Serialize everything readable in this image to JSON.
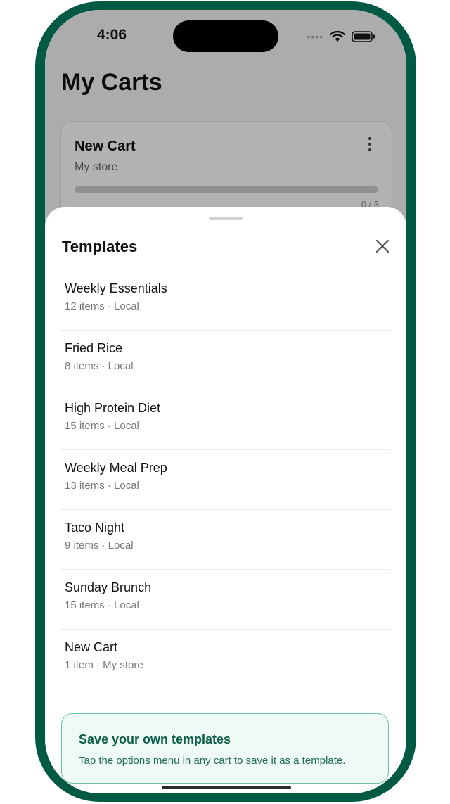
{
  "status_bar": {
    "time": "4:06"
  },
  "background": {
    "title": "My Carts",
    "card": {
      "title": "New Cart",
      "subtitle": "My store",
      "count": "0 / 3"
    }
  },
  "sheet": {
    "title": "Templates",
    "templates": [
      {
        "title": "Weekly Essentials",
        "subtitle": "12 items · Local"
      },
      {
        "title": "Fried Rice",
        "subtitle": "8 items · Local"
      },
      {
        "title": "High Protein Diet",
        "subtitle": "15 items · Local"
      },
      {
        "title": "Weekly Meal Prep",
        "subtitle": "13 items · Local"
      },
      {
        "title": "Taco Night",
        "subtitle": "9 items · Local"
      },
      {
        "title": "Sunday Brunch",
        "subtitle": "15 items · Local"
      },
      {
        "title": "New Cart",
        "subtitle": "1 item · My store"
      }
    ],
    "tip": {
      "title": "Save your own templates",
      "body": "Tap the options menu in any cart to save it as a template."
    }
  },
  "icons": {
    "close": "close-icon",
    "more": "more-vertical-icon",
    "wifi": "wifi-icon",
    "battery": "battery-icon"
  },
  "colors": {
    "device_frame": "#005a43",
    "accent_text": "#0b5e45",
    "tip_background": "#effaf4",
    "tip_border": "#6fc3a3"
  }
}
